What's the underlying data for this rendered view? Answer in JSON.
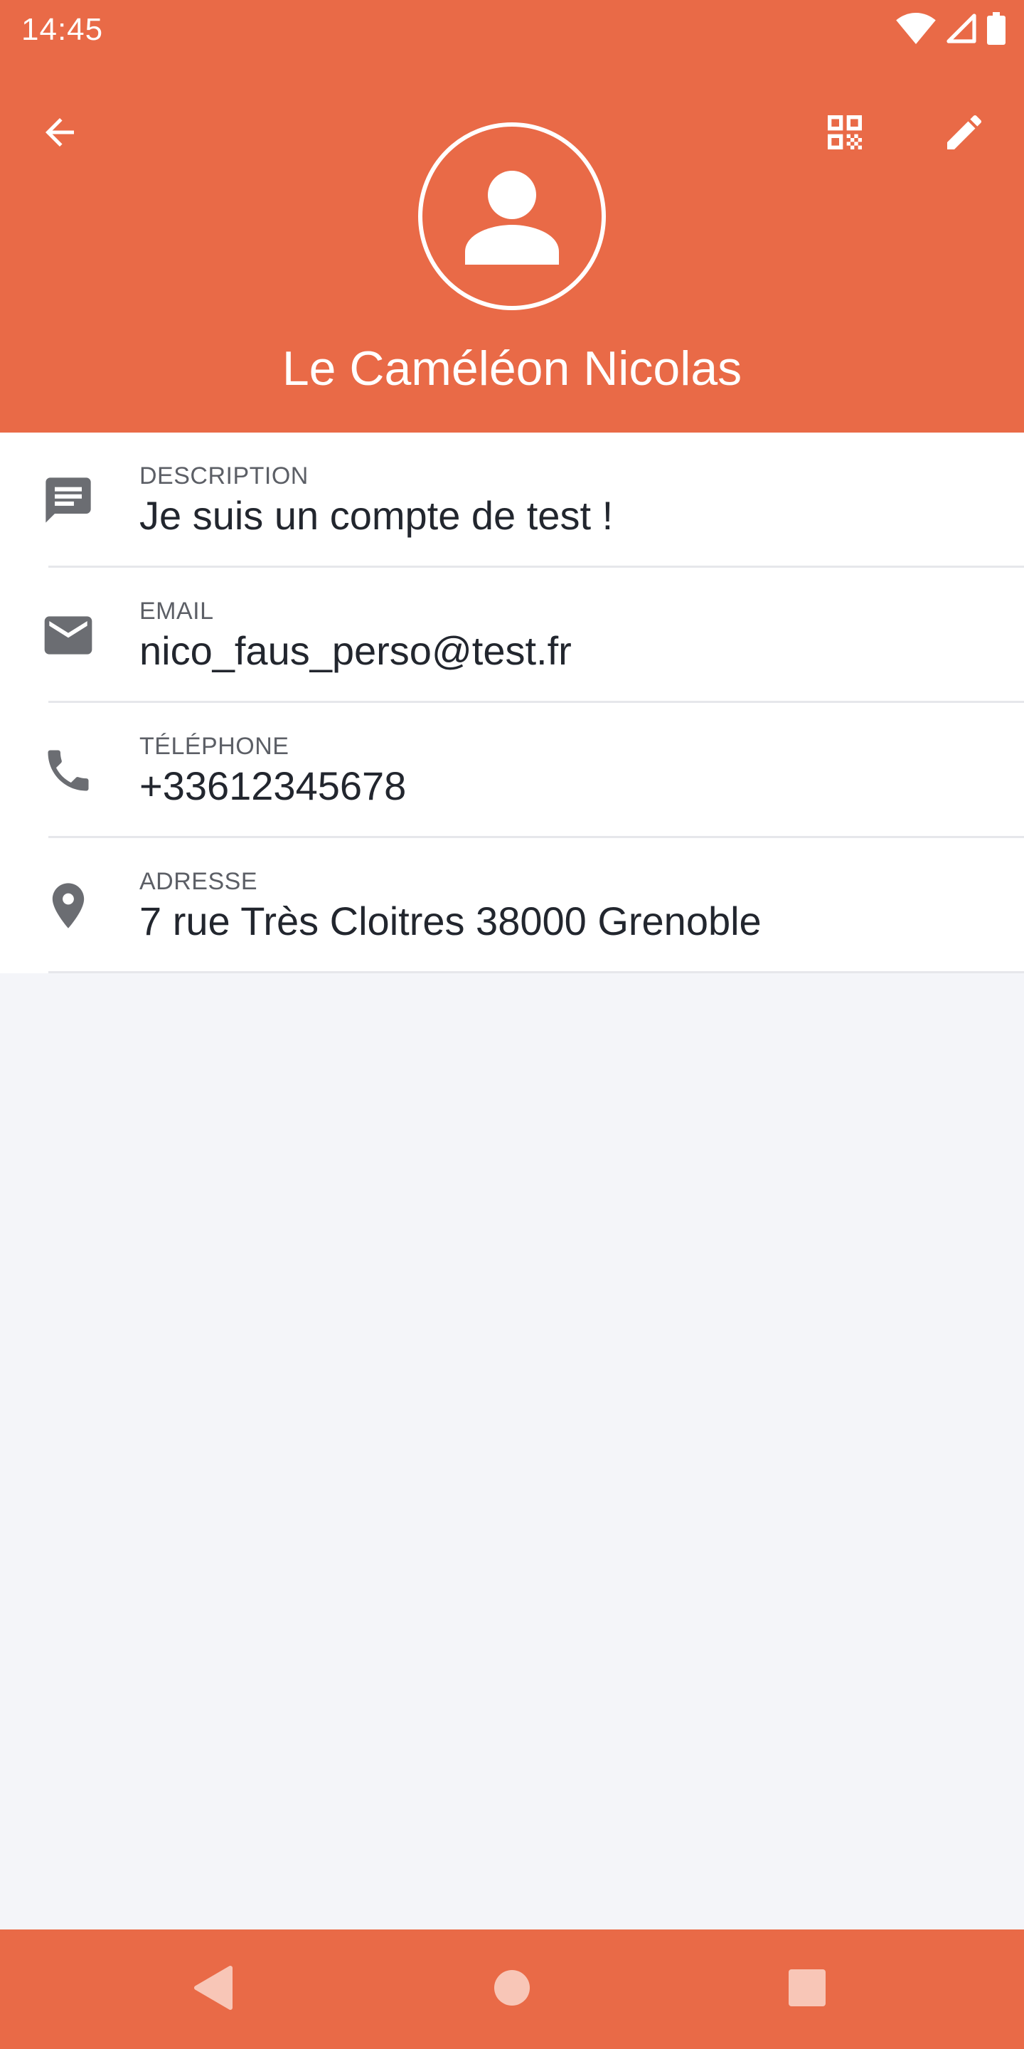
{
  "status_bar": {
    "time": "14:45",
    "icons": [
      "wifi-icon",
      "cellular-signal-icon",
      "battery-icon"
    ]
  },
  "header": {
    "contact_name": "Le Caméléon Nicolas",
    "actions": [
      "back-arrow-icon",
      "qr-code-icon",
      "edit-pencil-icon"
    ],
    "avatar_icon": "person-avatar-icon"
  },
  "details": [
    {
      "icon": "description-icon",
      "label": "DESCRIPTION",
      "value": "Je suis un compte de test !"
    },
    {
      "icon": "email-icon",
      "label": "EMAIL",
      "value": "nico_faus_perso@test.fr"
    },
    {
      "icon": "phone-icon",
      "label": "TÉLÉPHONE",
      "value": "+33612345678"
    },
    {
      "icon": "location-pin-icon",
      "label": "ADRESSE",
      "value": "7 rue Très Cloitres 38000 Grenoble"
    }
  ],
  "nav_bar": {
    "buttons": [
      "nav-back-triangle-icon",
      "nav-home-circle-icon",
      "nav-recents-square-icon"
    ]
  },
  "colors": {
    "accent": "#E96A47",
    "background": "#F4F5F9",
    "card": "#FFFFFF",
    "icon_gray": "#6B6D72",
    "text_dark": "#22262E",
    "label_gray": "#5C5F66"
  }
}
